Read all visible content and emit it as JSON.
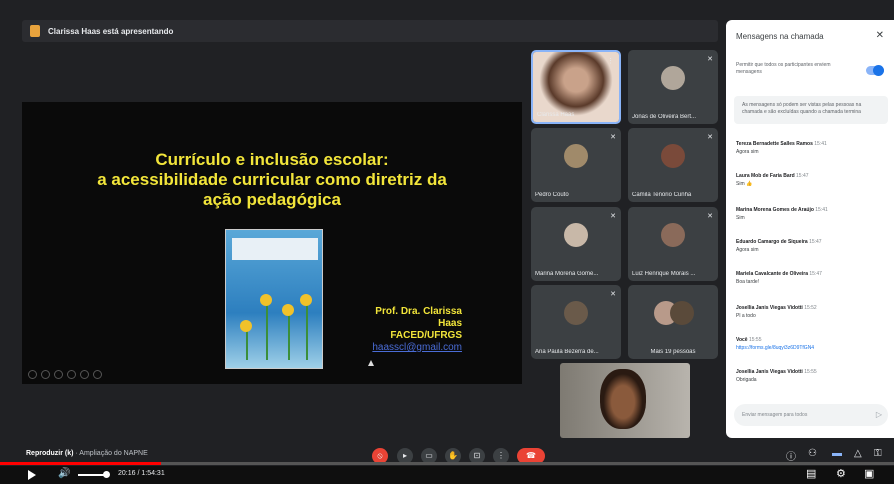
{
  "presenting_banner": "Clarissa Haas está apresentando",
  "slide": {
    "title_lines": [
      "Currículo e inclusão escolar:",
      "a acessibilidade curricular como diretriz da",
      "ação pedagógica"
    ],
    "author_name": "Prof. Dra. Clarissa Haas",
    "author_affiliation": "FACED/UFRGS",
    "author_email": "haasscl@gmail.com"
  },
  "participants": [
    {
      "name": "Clarissa Haas"
    },
    {
      "name": "Jonas de Oliveira Bert..."
    },
    {
      "name": "Pedro Couto"
    },
    {
      "name": "Camila Tenorio Cunha"
    },
    {
      "name": "Marina Morena Gome..."
    },
    {
      "name": "Luiz Henrique Morais ..."
    },
    {
      "name": "Ana Paula Bezerra de..."
    },
    {
      "name": "Mais 19 pessoas"
    }
  ],
  "chat": {
    "title": "Mensagens na chamada",
    "permission_text": "Permitir que todos os participantes enviem mensagens",
    "notice": "As mensagens só podem ser vistas pelas pessoas na chamada e são excluídas quando a chamada termina",
    "messages": [
      {
        "author": "Tereza Bernadette Salles Ramos",
        "time": "15:41",
        "text": "Agora sim"
      },
      {
        "author": "Laura Mob de Faria Bard",
        "time": "15:47",
        "text": "Sim 👍"
      },
      {
        "author": "Marina Morena Gomes de Araújo",
        "time": "15:41",
        "text": "Sim"
      },
      {
        "author": "Eduardo Camargo de Siqueira",
        "time": "15:47",
        "text": "Agora sim"
      },
      {
        "author": "Mariela Cavalcante de Oliveira",
        "time": "15:47",
        "text": "Boa tarde!"
      },
      {
        "author": "Josellia Janis Viegas Vidotti",
        "time": "15:52",
        "text": "Pl a todo"
      },
      {
        "author": "Você",
        "time": "15:55",
        "text": "https://forms.gle/8uqyi3z6D9TfGN4"
      },
      {
        "author": "Josellia Janis Viegas Vidotti",
        "time": "15:55",
        "text": "Obrigada"
      }
    ],
    "compose_placeholder": "Enviar mensagem para todos"
  },
  "player": {
    "chapter_prefix": "Reproduzir (k)",
    "chapter_title": "· Ampliação do NAPNE",
    "time": "20:16 / 1:54:31",
    "progress_fraction": 0.18
  },
  "colors": {
    "slide_text": "#f2e53a",
    "accent_blue": "#1a73e8",
    "hangup_red": "#ea4335",
    "progress_red": "#ff0000"
  }
}
